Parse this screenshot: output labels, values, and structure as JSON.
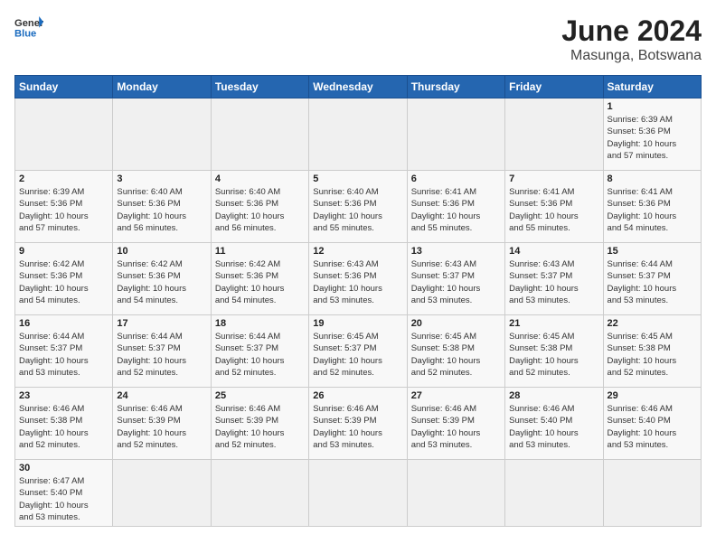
{
  "header": {
    "logo_general": "General",
    "logo_blue": "Blue",
    "month_year": "June 2024",
    "location": "Masunga, Botswana"
  },
  "weekdays": [
    "Sunday",
    "Monday",
    "Tuesday",
    "Wednesday",
    "Thursday",
    "Friday",
    "Saturday"
  ],
  "weeks": [
    [
      {
        "day": "",
        "info": ""
      },
      {
        "day": "",
        "info": ""
      },
      {
        "day": "",
        "info": ""
      },
      {
        "day": "",
        "info": ""
      },
      {
        "day": "",
        "info": ""
      },
      {
        "day": "",
        "info": ""
      },
      {
        "day": "1",
        "info": "Sunrise: 6:39 AM\nSunset: 5:36 PM\nDaylight: 10 hours\nand 57 minutes."
      }
    ],
    [
      {
        "day": "2",
        "info": "Sunrise: 6:39 AM\nSunset: 5:36 PM\nDaylight: 10 hours\nand 57 minutes."
      },
      {
        "day": "3",
        "info": "Sunrise: 6:40 AM\nSunset: 5:36 PM\nDaylight: 10 hours\nand 56 minutes."
      },
      {
        "day": "4",
        "info": "Sunrise: 6:40 AM\nSunset: 5:36 PM\nDaylight: 10 hours\nand 56 minutes."
      },
      {
        "day": "5",
        "info": "Sunrise: 6:40 AM\nSunset: 5:36 PM\nDaylight: 10 hours\nand 55 minutes."
      },
      {
        "day": "6",
        "info": "Sunrise: 6:41 AM\nSunset: 5:36 PM\nDaylight: 10 hours\nand 55 minutes."
      },
      {
        "day": "7",
        "info": "Sunrise: 6:41 AM\nSunset: 5:36 PM\nDaylight: 10 hours\nand 55 minutes."
      },
      {
        "day": "8",
        "info": "Sunrise: 6:41 AM\nSunset: 5:36 PM\nDaylight: 10 hours\nand 54 minutes."
      }
    ],
    [
      {
        "day": "9",
        "info": "Sunrise: 6:42 AM\nSunset: 5:36 PM\nDaylight: 10 hours\nand 54 minutes."
      },
      {
        "day": "10",
        "info": "Sunrise: 6:42 AM\nSunset: 5:36 PM\nDaylight: 10 hours\nand 54 minutes."
      },
      {
        "day": "11",
        "info": "Sunrise: 6:42 AM\nSunset: 5:36 PM\nDaylight: 10 hours\nand 54 minutes."
      },
      {
        "day": "12",
        "info": "Sunrise: 6:43 AM\nSunset: 5:36 PM\nDaylight: 10 hours\nand 53 minutes."
      },
      {
        "day": "13",
        "info": "Sunrise: 6:43 AM\nSunset: 5:37 PM\nDaylight: 10 hours\nand 53 minutes."
      },
      {
        "day": "14",
        "info": "Sunrise: 6:43 AM\nSunset: 5:37 PM\nDaylight: 10 hours\nand 53 minutes."
      },
      {
        "day": "15",
        "info": "Sunrise: 6:44 AM\nSunset: 5:37 PM\nDaylight: 10 hours\nand 53 minutes."
      }
    ],
    [
      {
        "day": "16",
        "info": "Sunrise: 6:44 AM\nSunset: 5:37 PM\nDaylight: 10 hours\nand 53 minutes."
      },
      {
        "day": "17",
        "info": "Sunrise: 6:44 AM\nSunset: 5:37 PM\nDaylight: 10 hours\nand 52 minutes."
      },
      {
        "day": "18",
        "info": "Sunrise: 6:44 AM\nSunset: 5:37 PM\nDaylight: 10 hours\nand 52 minutes."
      },
      {
        "day": "19",
        "info": "Sunrise: 6:45 AM\nSunset: 5:37 PM\nDaylight: 10 hours\nand 52 minutes."
      },
      {
        "day": "20",
        "info": "Sunrise: 6:45 AM\nSunset: 5:38 PM\nDaylight: 10 hours\nand 52 minutes."
      },
      {
        "day": "21",
        "info": "Sunrise: 6:45 AM\nSunset: 5:38 PM\nDaylight: 10 hours\nand 52 minutes."
      },
      {
        "day": "22",
        "info": "Sunrise: 6:45 AM\nSunset: 5:38 PM\nDaylight: 10 hours\nand 52 minutes."
      }
    ],
    [
      {
        "day": "23",
        "info": "Sunrise: 6:46 AM\nSunset: 5:38 PM\nDaylight: 10 hours\nand 52 minutes."
      },
      {
        "day": "24",
        "info": "Sunrise: 6:46 AM\nSunset: 5:39 PM\nDaylight: 10 hours\nand 52 minutes."
      },
      {
        "day": "25",
        "info": "Sunrise: 6:46 AM\nSunset: 5:39 PM\nDaylight: 10 hours\nand 52 minutes."
      },
      {
        "day": "26",
        "info": "Sunrise: 6:46 AM\nSunset: 5:39 PM\nDaylight: 10 hours\nand 53 minutes."
      },
      {
        "day": "27",
        "info": "Sunrise: 6:46 AM\nSunset: 5:39 PM\nDaylight: 10 hours\nand 53 minutes."
      },
      {
        "day": "28",
        "info": "Sunrise: 6:46 AM\nSunset: 5:40 PM\nDaylight: 10 hours\nand 53 minutes."
      },
      {
        "day": "29",
        "info": "Sunrise: 6:46 AM\nSunset: 5:40 PM\nDaylight: 10 hours\nand 53 minutes."
      }
    ],
    [
      {
        "day": "30",
        "info": "Sunrise: 6:47 AM\nSunset: 5:40 PM\nDaylight: 10 hours\nand 53 minutes."
      },
      {
        "day": "",
        "info": ""
      },
      {
        "day": "",
        "info": ""
      },
      {
        "day": "",
        "info": ""
      },
      {
        "day": "",
        "info": ""
      },
      {
        "day": "",
        "info": ""
      },
      {
        "day": "",
        "info": ""
      }
    ]
  ]
}
